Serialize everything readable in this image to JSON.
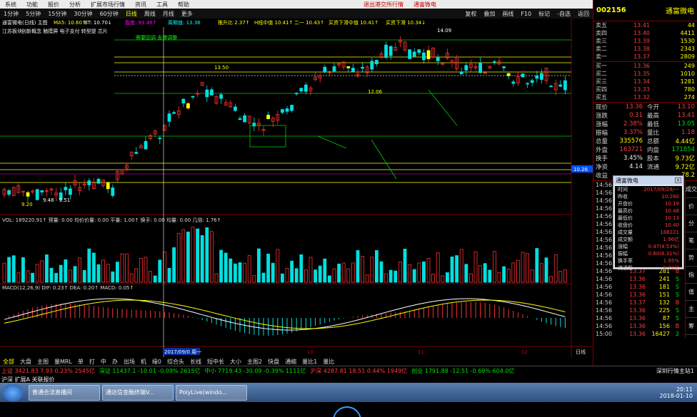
{
  "menu": [
    "系统",
    "功能",
    "报价",
    "分析",
    "扩展市场行情",
    "资讯",
    "工具",
    "帮助"
  ],
  "menu_center": [
    "退出港交所行情",
    "通富微电"
  ],
  "top_right": [
    "行情",
    "资讯",
    "交易",
    "服务"
  ],
  "periods": [
    "1分钟",
    "5分钟",
    "15分钟",
    "30分钟",
    "60分钟",
    "日线",
    "周线",
    "月线",
    "更多"
  ],
  "tools_right": [
    "复权",
    "叠加",
    "画线",
    "F10",
    "标记",
    "-自选",
    "返回"
  ],
  "chart": {
    "title": "通富微电(日线) 主图",
    "ma_labels": [
      "MA5: 10.60↑",
      "BT: 10.70↓",
      "盈度: 93.46↑",
      "周期值: 13.36"
    ],
    "ma_colors": [
      "#ff0",
      "#fff",
      "#f0f",
      "#0ff"
    ],
    "annot": [
      "推升比 2.37↑",
      "H线中值 10.41↑",
      "二一 10.43↑",
      "买资下滑中值 10.41↑",
      "买资下滑 10.34↓"
    ],
    "sector": "江苏板块",
    "concepts": "创新概念 触摸屏 电子支付 转型提 芯片",
    "note": "需要回调 支撑调整",
    "price_labels": [
      "14.09",
      "13.50",
      "12.06",
      "9.20",
      "9.48 - 9.51"
    ],
    "price_tag": "10.26",
    "vol_row": "VOL: 189220.91↑  预量: 0.00  均价价量: 0.00  平量: 1.00↑  换手: 0.00  均量: 0.00  几倍: 1.76↑",
    "macd_row": "MACD(12,26,9)  DIF: 0.23↑  DEA: 0.20↑  MACD: 0.05↑",
    "date_label": "2017/09/0 周一",
    "x_labels": [
      "10",
      "11",
      "12"
    ],
    "right_label": "日线"
  },
  "bottom_tabs": [
    "全部",
    "大盘",
    "主图",
    "量MRL",
    "单",
    "打",
    "中",
    "办",
    "出场",
    "机",
    "缘0",
    "综合头",
    "长线",
    "短中长",
    "大小",
    "主图2",
    "快盘",
    "通缩",
    "量比1",
    "量比"
  ],
  "status": [
    "上证 3421.83 7.93 0.23% 2545亿",
    "深证 11437.1 -10.01 -0.09% 2615亿",
    "中小 7719.43 -30.09 -0.39% 1111亿",
    "沪深 4287.81 18.51 0.44% 1949亿",
    "创业 1791.88 -12.51 -0.69% 604.0亿",
    "深圳行情主站1"
  ],
  "status_row2": "沪深 扩展A 关联报价",
  "stock": {
    "code": "002156",
    "name": "通富微电"
  },
  "orderbook": [
    {
      "l": "卖五",
      "p": "13.41",
      "v": "44"
    },
    {
      "l": "卖四",
      "p": "13.40",
      "v": "4411"
    },
    {
      "l": "卖三",
      "p": "13.39",
      "v": "1530"
    },
    {
      "l": "卖二",
      "p": "13.38",
      "v": "2343"
    },
    {
      "l": "卖一",
      "p": "13.37",
      "v": "2809"
    },
    {
      "l": "买一",
      "p": "13.36",
      "v": "249"
    },
    {
      "l": "买二",
      "p": "13.35",
      "v": "1010"
    },
    {
      "l": "买三",
      "p": "13.34",
      "v": "1281"
    },
    {
      "l": "买四",
      "p": "13.33",
      "v": "780"
    },
    {
      "l": "买五",
      "p": "13.32",
      "v": "274"
    }
  ],
  "info": [
    {
      "a": "现价",
      "b": "13.36",
      "c": "今开",
      "d": "13.10"
    },
    {
      "a": "涨跌",
      "b": "0.31",
      "c": "最高",
      "d": "13.41"
    },
    {
      "a": "涨幅",
      "b": "2.38%",
      "c": "最低",
      "d": "13.05"
    },
    {
      "a": "振幅",
      "b": "3.37%",
      "c": "量比",
      "d": "1.18"
    },
    {
      "a": "总量",
      "b": "335576",
      "c": "总额",
      "d": "4.44亿"
    },
    {
      "a": "外盘",
      "b": "163721",
      "c": "内盘",
      "d": "171854"
    },
    {
      "a": "换手",
      "b": "3.45%",
      "c": "股本",
      "d": "9.73亿"
    },
    {
      "a": "净资",
      "b": "4.14",
      "c": "流通",
      "d": "9.72亿"
    },
    {
      "a": "收益",
      "b": "",
      "c": "",
      "d": "78.2"
    }
  ],
  "ticks": [
    {
      "t": "14:56",
      "p": "13.36",
      "v": "20",
      "s": "S"
    },
    {
      "t": "14:56",
      "p": "13.36",
      "v": "5",
      "s": "S"
    },
    {
      "t": "14:56",
      "p": "13.36",
      "v": "4",
      "s": "S"
    },
    {
      "t": "14:56",
      "p": "13.36",
      "v": "10",
      "s": "B"
    },
    {
      "t": "14:56",
      "p": "13.36",
      "v": "8",
      "s": "S"
    },
    {
      "t": "14:56",
      "p": "13.36",
      "v": "3",
      "s": "B"
    },
    {
      "t": "14:56",
      "p": "13.36",
      "v": "12",
      "s": "S"
    },
    {
      "t": "14:56",
      "p": "13.36",
      "v": "6",
      "s": "S"
    },
    {
      "t": "14:56",
      "p": "13.36",
      "v": "9",
      "s": "B"
    },
    {
      "t": "14:56",
      "p": "13.36",
      "v": "115",
      "s": "S"
    },
    {
      "t": "14:56",
      "p": "13.36",
      "v": "309",
      "s": "S"
    },
    {
      "t": "14:56",
      "p": "13.37",
      "v": "281",
      "s": "B"
    },
    {
      "t": "14:56",
      "p": "13.36",
      "v": "241",
      "s": "S"
    },
    {
      "t": "14:56",
      "p": "13.36",
      "v": "181",
      "s": "S"
    },
    {
      "t": "14:56",
      "p": "13.36",
      "v": "151",
      "s": "S"
    },
    {
      "t": "14:56",
      "p": "13.37",
      "v": "132",
      "s": "B"
    },
    {
      "t": "14:56",
      "p": "13.36",
      "v": "225",
      "s": "S"
    },
    {
      "t": "14:56",
      "p": "13.36",
      "v": "87",
      "s": "S"
    },
    {
      "t": "14:56",
      "p": "13.36",
      "v": "156",
      "s": "B"
    },
    {
      "t": "15:00",
      "p": "13.36",
      "v": "16427",
      "s": "2"
    }
  ],
  "popup": {
    "title": "通富微电",
    "rows": [
      {
        "k": "时间",
        "v": "2017/09/29/一"
      },
      {
        "k": "昨收",
        "v": "10.260"
      },
      {
        "k": "开盘价",
        "v": "10.19"
      },
      {
        "k": "最高价",
        "v": "10.48"
      },
      {
        "k": "最低价",
        "v": "10.13"
      },
      {
        "k": "收盘价",
        "v": "10.40"
      },
      {
        "k": "成交量",
        "v": "188221"
      },
      {
        "k": "成交额",
        "v": "1.96亿"
      },
      {
        "k": "涨幅",
        "v": "0.47(4.53%)"
      },
      {
        "k": "振幅",
        "v": "0.60(6.31%)"
      },
      {
        "k": "换手率",
        "v": "1.95%"
      },
      {
        "k": "流通股",
        "v": "9.72亿"
      }
    ]
  },
  "tab_rows": [
    "成交",
    "价",
    "分",
    "笔",
    "势",
    "指",
    "值",
    "主",
    "筹"
  ],
  "taskbar": [
    "普通合法直播间",
    "通达信金融终端V...",
    "PolyLive(windo..."
  ],
  "clock": [
    "20:11",
    "2018-01-10"
  ]
}
